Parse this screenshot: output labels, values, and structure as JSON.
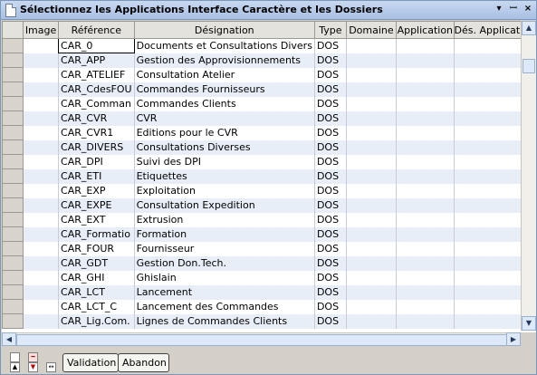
{
  "window": {
    "title": "Sélectionnez les Applications Interface Caractère et les Dossiers",
    "dropdown_glyph": "▾",
    "pin_glyph": "ꟷ",
    "close_glyph": "×"
  },
  "grid": {
    "columns": {
      "image": "Image",
      "reference": "Référence",
      "designation": "Désignation",
      "type": "Type",
      "domaine": "Domaine",
      "application": "Application",
      "des_application": "Dés. Application"
    },
    "rows": [
      {
        "reference": "CAR_0",
        "designation": "Documents et Consultations Divers",
        "type": "DOS"
      },
      {
        "reference": "CAR_APP",
        "designation": "Gestion des Approvisionnements",
        "type": "DOS"
      },
      {
        "reference": "CAR_ATELIEF",
        "designation": "Consultation Atelier",
        "type": "DOS"
      },
      {
        "reference": "CAR_CdesFOU",
        "designation": "Commandes Fournisseurs",
        "type": "DOS"
      },
      {
        "reference": "CAR_Comman",
        "designation": "Commandes Clients",
        "type": "DOS"
      },
      {
        "reference": "CAR_CVR",
        "designation": "CVR",
        "type": "DOS"
      },
      {
        "reference": "CAR_CVR1",
        "designation": "Editions pour le CVR",
        "type": "DOS"
      },
      {
        "reference": "CAR_DIVERS",
        "designation": "Consultations Diverses",
        "type": "DOS"
      },
      {
        "reference": "CAR_DPI",
        "designation": "Suivi des DPI",
        "type": "DOS"
      },
      {
        "reference": "CAR_ETI",
        "designation": "Etiquettes",
        "type": "DOS"
      },
      {
        "reference": "CAR_EXP",
        "designation": "Exploitation",
        "type": "DOS"
      },
      {
        "reference": "CAR_EXPE",
        "designation": "Consultation Expedition",
        "type": "DOS"
      },
      {
        "reference": "CAR_EXT",
        "designation": "Extrusion",
        "type": "DOS"
      },
      {
        "reference": "CAR_Formatio",
        "designation": "Formation",
        "type": "DOS"
      },
      {
        "reference": "CAR_FOUR",
        "designation": "Fournisseur",
        "type": "DOS"
      },
      {
        "reference": "CAR_GDT",
        "designation": "Gestion Don.Tech.",
        "type": "DOS"
      },
      {
        "reference": "CAR_GHI",
        "designation": "Ghislain",
        "type": "DOS"
      },
      {
        "reference": "CAR_LCT",
        "designation": "Lancement",
        "type": "DOS"
      },
      {
        "reference": "CAR_LCT_C",
        "designation": "Lancement des Commandes",
        "type": "DOS"
      },
      {
        "reference": "CAR_Lig.Com.",
        "designation": "Lignes de Commandes Clients",
        "type": "DOS"
      }
    ]
  },
  "scroll": {
    "up": "▲",
    "down": "▼",
    "left": "◀",
    "right": "▶"
  },
  "footer": {
    "validation_label": "Validation",
    "abandon_label": "Abandon"
  },
  "colors": {
    "alt_row": "#e8eef8",
    "title_bar": "#c8d8f0"
  }
}
